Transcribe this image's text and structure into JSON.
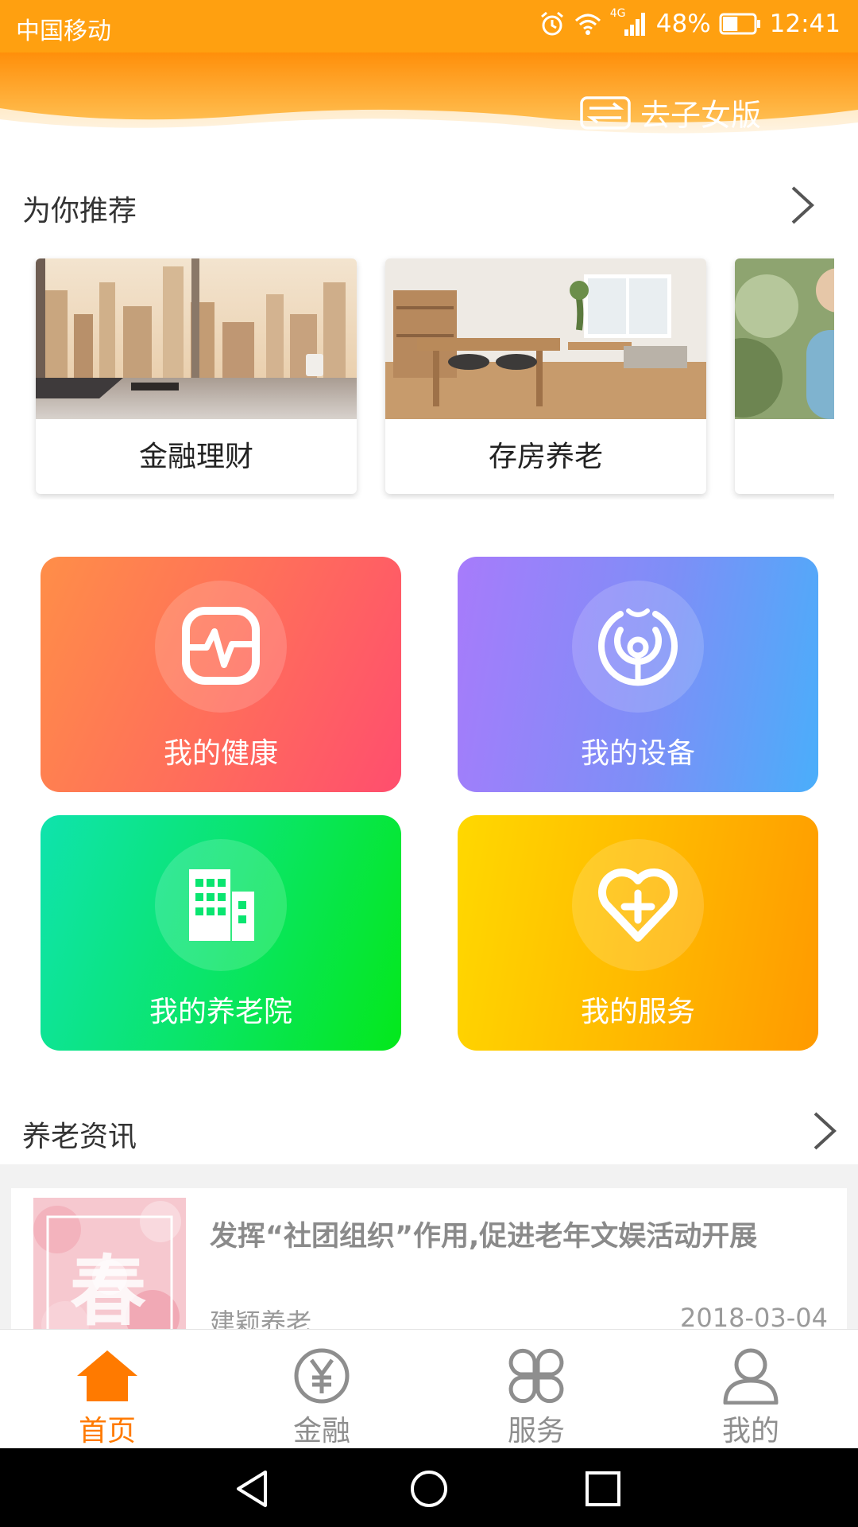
{
  "status_bar": {
    "carrier": "中国移动",
    "network": "4G",
    "battery": "48%",
    "battery_level": 0.48,
    "time": "12:41"
  },
  "header": {
    "switch_label": "去子女版",
    "switch_icon": "switch-arrows-icon",
    "colors": {
      "primary": "#ffa010",
      "accent": "#ff7a00"
    }
  },
  "recommend": {
    "title": "为你推荐",
    "items": [
      {
        "label": "金融理财",
        "image": "city-office-photo"
      },
      {
        "label": "存房养老",
        "image": "living-room-photo"
      },
      {
        "label": "",
        "image": "senior-person-photo"
      }
    ]
  },
  "tiles": [
    {
      "label": "我的健康",
      "icon": "heart-monitor-icon"
    },
    {
      "label": "我的设备",
      "icon": "signal-device-icon"
    },
    {
      "label": "我的养老院",
      "icon": "building-icon"
    },
    {
      "label": "我的服务",
      "icon": "heart-plus-icon"
    }
  ],
  "news": {
    "title": "养老资讯",
    "items": [
      {
        "title": "发挥“社团组织”作用,促进老年文娱活动开展",
        "source": "建颖养老",
        "date": "2018-03-04",
        "thumb_text": "春"
      }
    ]
  },
  "tabbar": {
    "items": [
      {
        "label": "首页",
        "icon": "home-icon",
        "active": true
      },
      {
        "label": "金融",
        "icon": "yen-icon",
        "active": false
      },
      {
        "label": "服务",
        "icon": "grid-icon",
        "active": false
      },
      {
        "label": "我的",
        "icon": "person-icon",
        "active": false
      }
    ]
  },
  "system_nav": [
    "back-icon",
    "home-circle-icon",
    "recents-icon"
  ]
}
